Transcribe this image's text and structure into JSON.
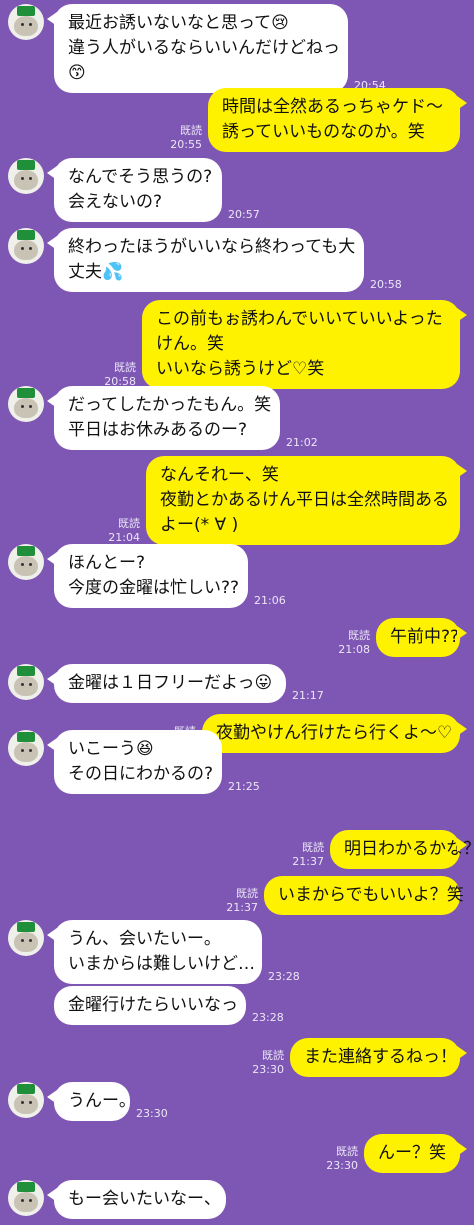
{
  "chat": {
    "read_label": "既読",
    "messages": [
      {
        "from": "them",
        "text": "最近お誘いないなと思って😢\n違う人がいるならいいんだけどねっ\n😙",
        "time": "20:54"
      },
      {
        "from": "me",
        "text": "時間は全然あるっちゃケド〜\n誘っていいものなのか。笑",
        "time": "20:55",
        "read": true
      },
      {
        "from": "them",
        "text": "なんでそう思うの?\n会えないの?",
        "time": "20:57"
      },
      {
        "from": "them",
        "text": "終わったほうがいいなら終わっても大\n丈夫💦",
        "time": "20:58"
      },
      {
        "from": "me",
        "text": "この前もぉ誘わんでいいていいよった\nけん。笑\nいいなら誘うけど♡笑",
        "time": "20:58",
        "read": true
      },
      {
        "from": "them",
        "text": "だってしたかったもん。笑\n平日はお休みあるのー?",
        "time": "21:02"
      },
      {
        "from": "me",
        "text": "なんそれー、笑\n夜勤とかあるけん平日は全然時間ある\nよー(* ∀ )",
        "time": "21:04",
        "read": true
      },
      {
        "from": "them",
        "text": "ほんとー?\n今度の金曜は忙しい??",
        "time": "21:06"
      },
      {
        "from": "me",
        "text": "午前中??",
        "time": "21:08",
        "read": true
      },
      {
        "from": "them",
        "text": "金曜は１日フリーだよっ😛",
        "time": "21:17"
      },
      {
        "from": "me",
        "text": "夜勤やけん行けたら行くよ〜♡",
        "time": "21:18",
        "read": true
      },
      {
        "from": "them",
        "text": "いこーう😆\nその日にわかるの?",
        "time": "21:25"
      },
      {
        "from": "me",
        "text": "明日わかるかな？",
        "time": "21:37",
        "read": true
      },
      {
        "from": "me",
        "text": "いまからでもいいよ？笑",
        "time": "21:37",
        "read": true
      },
      {
        "from": "them",
        "text": "うん、会いたいー。\nいまからは難しいけど…",
        "time": "23:28"
      },
      {
        "from": "them",
        "text": "金曜行けたらいいなっ",
        "time": "23:28"
      },
      {
        "from": "me",
        "text": "また連絡するねっ！",
        "time": "23:30",
        "read": true
      },
      {
        "from": "them",
        "text": "うんー。",
        "time": "23:30"
      },
      {
        "from": "me",
        "text": "んー？笑",
        "time": "23:30",
        "read": true
      },
      {
        "from": "them",
        "text": "もー会いたいなー、",
        "time": ""
      }
    ]
  }
}
